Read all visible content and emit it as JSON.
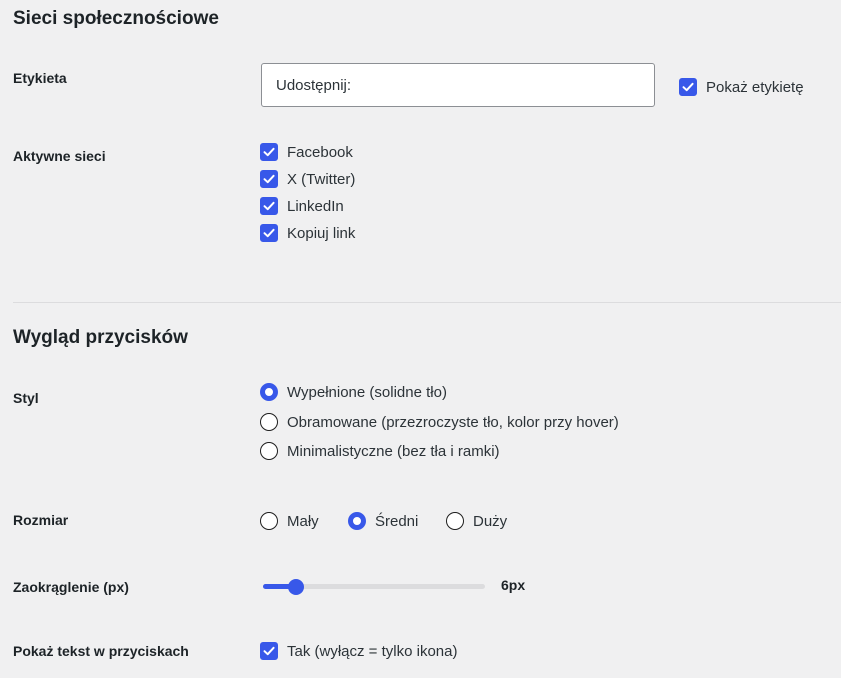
{
  "section_social": {
    "title": "Sieci społecznościowe",
    "label_row": {
      "label": "Etykieta",
      "input_value": "Udostępnij:",
      "show_label": {
        "label": "Pokaż etykietę",
        "checked": true
      }
    },
    "networks": {
      "label": "Aktywne sieci",
      "items": [
        {
          "label": "Facebook",
          "checked": true
        },
        {
          "label": "X (Twitter)",
          "checked": true
        },
        {
          "label": "LinkedIn",
          "checked": true
        },
        {
          "label": "Kopiuj link",
          "checked": true
        }
      ]
    }
  },
  "section_appearance": {
    "title": "Wygląd przycisków",
    "style": {
      "label": "Styl",
      "options": [
        {
          "label": "Wypełnione (solidne tło)",
          "selected": true
        },
        {
          "label": "Obramowane (przezroczyste tło, kolor przy hover)",
          "selected": false
        },
        {
          "label": "Minimalistyczne (bez tła i ramki)",
          "selected": false
        }
      ]
    },
    "size": {
      "label": "Rozmiar",
      "options": [
        {
          "label": "Mały",
          "selected": false
        },
        {
          "label": "Średni",
          "selected": true
        },
        {
          "label": "Duży",
          "selected": false
        }
      ]
    },
    "radius": {
      "label": "Zaokrąglenie (px)",
      "value_text": "6px",
      "fraction": 0.15
    },
    "show_text": {
      "label": "Pokaż tekst w przyciskach",
      "checkbox_label": "Tak (wyłącz = tylko ikona)",
      "checked": true
    }
  },
  "colors": {
    "accent": "#3858e9",
    "background": "#f0f0f1",
    "text": "#1d2327"
  }
}
